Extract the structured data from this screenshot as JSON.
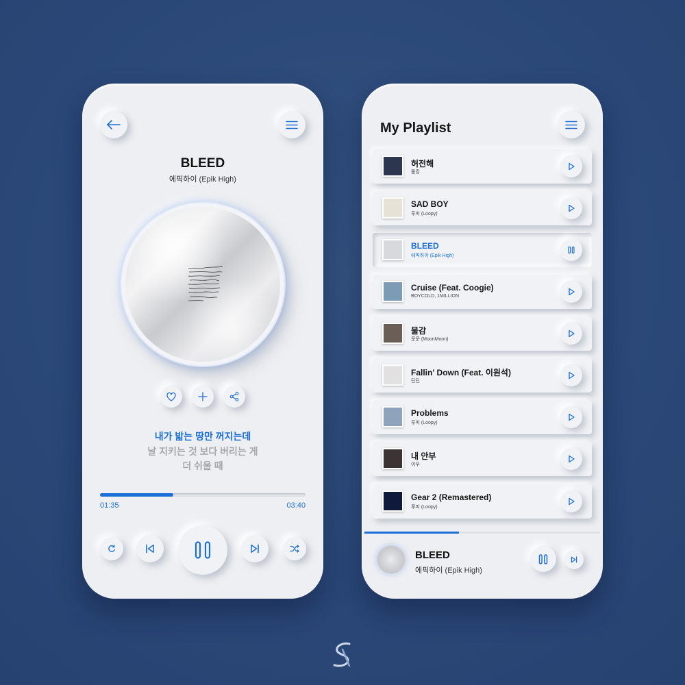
{
  "colors": {
    "accent": "#1a6fd6",
    "background": "#2b4878",
    "panel": "#eeeff2"
  },
  "player": {
    "song_title": "BLEED",
    "artist": "에픽하이 (Epik High)",
    "lyrics_current": "내가 밟는 땅만 꺼지는데",
    "lyrics_next_1": "날 지키는 것 보다 버리는 게",
    "lyrics_next_2": "더 쉬울 때",
    "elapsed": "01:35",
    "duration": "03:40",
    "progress": 0.358,
    "icons": {
      "back": "arrow-left-icon",
      "menu": "hamburger-icon",
      "like": "heart-icon",
      "add": "plus-icon",
      "share": "share-icon",
      "repeat": "repeat-icon",
      "previous": "skip-previous-icon",
      "play_pause": "pause-icon",
      "next": "skip-next-icon",
      "shuffle": "shuffle-icon"
    }
  },
  "playlist": {
    "title": "My Playlist",
    "tracks": [
      {
        "name": "허전해",
        "artist": "톨킹",
        "active": false,
        "art": "#2c3650"
      },
      {
        "name": "SAD BOY",
        "artist": "루피 (Loopy)",
        "active": false,
        "art": "#e7e2d6"
      },
      {
        "name": "BLEED",
        "artist": "에픽하이 (Epik High)",
        "active": true,
        "art": "#d8d9dc"
      },
      {
        "name": "Cruise (Feat. Coogie)",
        "artist": "BOYCOLD, 1MILLION",
        "active": false,
        "art": "#7c9bb4"
      },
      {
        "name": "물감",
        "artist": "문문 (MoonMoon)",
        "active": false,
        "art": "#6b5e57"
      },
      {
        "name": "Fallin' Down (Feat. 이원석)",
        "artist": "딘딘",
        "active": false,
        "art": "#e1e1e1"
      },
      {
        "name": "Problems",
        "artist": "루피 (Loopy)",
        "active": false,
        "art": "#8fa3bc"
      },
      {
        "name": "내 안부",
        "artist": "이우",
        "active": false,
        "art": "#3c3334"
      },
      {
        "name": "Gear 2 (Remastered)",
        "artist": "루피 (Loopy)",
        "active": false,
        "art": "#0e1a3c"
      }
    ],
    "now_playing": {
      "title": "BLEED",
      "artist": "에픽하이 (Epik High)",
      "progress": 0.4
    }
  }
}
